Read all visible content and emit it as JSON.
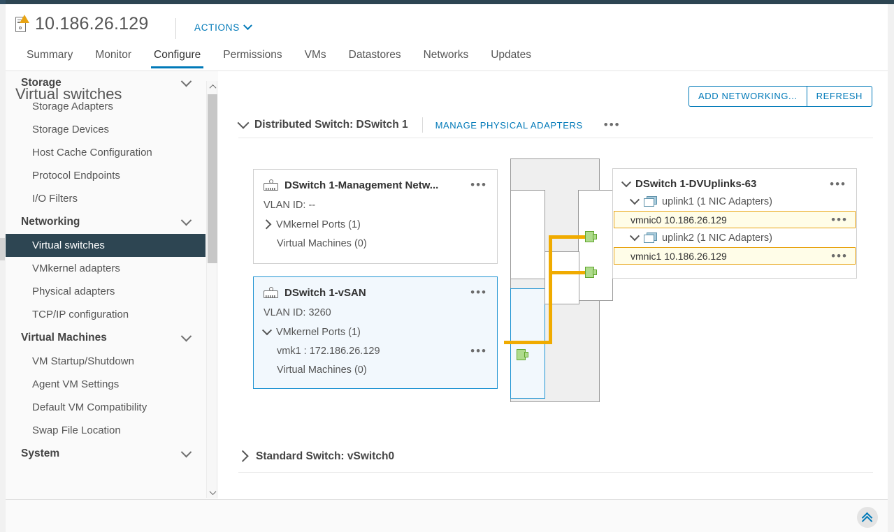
{
  "header": {
    "host_name": "10.186.26.129",
    "host_icon": "host-warning-icon",
    "actions_label": "ACTIONS"
  },
  "tabs": [
    {
      "label": "Summary",
      "active": false
    },
    {
      "label": "Monitor",
      "active": false
    },
    {
      "label": "Configure",
      "active": true
    },
    {
      "label": "Permissions",
      "active": false
    },
    {
      "label": "VMs",
      "active": false
    },
    {
      "label": "Datastores",
      "active": false
    },
    {
      "label": "Networks",
      "active": false
    },
    {
      "label": "Updates",
      "active": false
    }
  ],
  "sidebar": {
    "groups": [
      {
        "label": "Storage",
        "items": [
          {
            "label": "Storage Adapters"
          },
          {
            "label": "Storage Devices"
          },
          {
            "label": "Host Cache Configuration"
          },
          {
            "label": "Protocol Endpoints"
          },
          {
            "label": "I/O Filters"
          }
        ]
      },
      {
        "label": "Networking",
        "items": [
          {
            "label": "Virtual switches",
            "selected": true
          },
          {
            "label": "VMkernel adapters"
          },
          {
            "label": "Physical adapters"
          },
          {
            "label": "TCP/IP configuration"
          }
        ]
      },
      {
        "label": "Virtual Machines",
        "items": [
          {
            "label": "VM Startup/Shutdown"
          },
          {
            "label": "Agent VM Settings"
          },
          {
            "label": "Default VM Compatibility"
          },
          {
            "label": "Swap File Location"
          }
        ]
      },
      {
        "label": "System",
        "items": []
      }
    ]
  },
  "main": {
    "title": "Virtual switches",
    "buttons": {
      "add_networking": "ADD NETWORKING...",
      "refresh": "REFRESH"
    },
    "distributed_switch": {
      "title": "Distributed Switch: DSwitch 1",
      "manage_adapters_label": "MANAGE PHYSICAL ADAPTERS",
      "more_menu": "•••",
      "expanded": true
    },
    "standard_switch": {
      "title": "Standard Switch: vSwitch0",
      "expanded": false
    },
    "portgroups": [
      {
        "name": "DSwitch 1-Management Netw...",
        "vlan_label": "VLAN ID: --",
        "vmkernel_ports": "VMkernel Ports (1)",
        "vmkernel_expanded": false,
        "virtual_machines": "Virtual Machines (0)",
        "selected": false,
        "more_menu": "•••"
      },
      {
        "name": "DSwitch 1-vSAN",
        "vlan_label": "VLAN ID: 3260",
        "vmkernel_ports": "VMkernel Ports (1)",
        "vmkernel_expanded": true,
        "vmk_entry": "vmk1 : 172.186.26.129",
        "virtual_machines": "Virtual Machines (0)",
        "selected": true,
        "more_menu": "•••"
      }
    ],
    "uplinks": {
      "title": "DSwitch 1-DVUplinks-63",
      "more_menu": "•••",
      "items": [
        {
          "label": "uplink1 (1 NIC Adapters)",
          "nic": "vmnic0 10.186.26.129",
          "nic_more": "•••"
        },
        {
          "label": "uplink2 (1 NIC Adapters)",
          "nic": "vmnic1 10.186.26.129",
          "nic_more": "•••"
        }
      ]
    }
  },
  "footer": {
    "scroll_top_icon": "double-chevron-up-icon"
  },
  "colors": {
    "accent_blue": "#0079b8",
    "selected_nav": "#2d4552",
    "wire_orange": "#f0ab00",
    "status_green": "#aedb8c",
    "highlight_yellow_bg": "#fffde8",
    "highlight_yellow_border": "#e8a413",
    "selection_blue": "#1f93d2"
  }
}
